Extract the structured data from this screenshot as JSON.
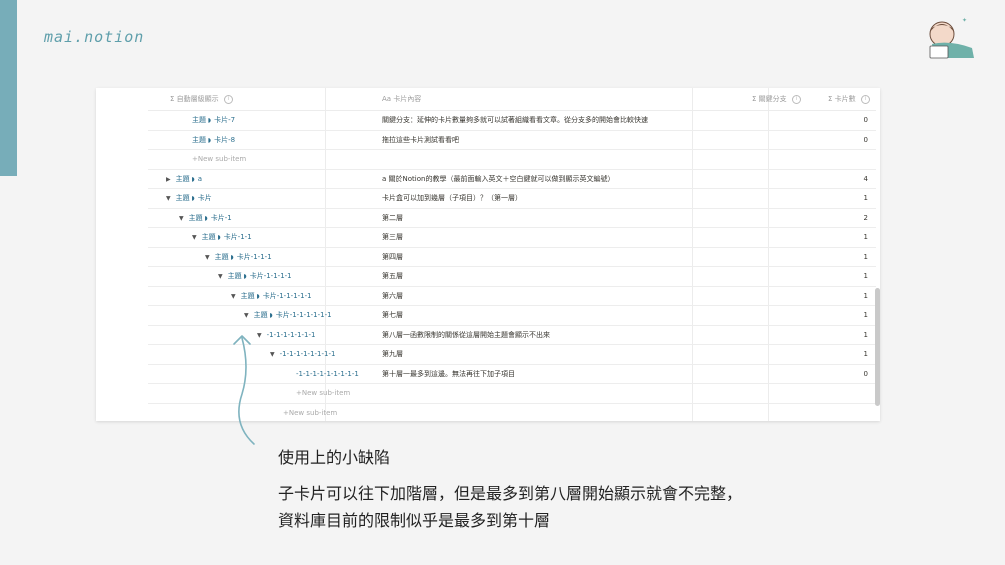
{
  "brand": "mai.notion",
  "columns": {
    "c1": "自動層級顯示",
    "c2": "卡片內容",
    "c2_prefix": "Aa",
    "c3": "關鍵分支",
    "c4": "卡片數",
    "sigma": "Σ",
    "info": "i"
  },
  "rows": [
    {
      "indent": 44,
      "toggle": "",
      "tag": "主題",
      "name": "卡片-7",
      "content": "關鍵分支：延伸的卡片數量夠多就可以試著組織看看文章。從分支多的開始會比較快速",
      "count": "0"
    },
    {
      "indent": 44,
      "toggle": "",
      "tag": "主題",
      "name": "卡片-8",
      "content": "拖拉這些卡片測試看看吧",
      "count": "0"
    },
    {
      "indent": 44,
      "new": true,
      "label": "New sub-item"
    },
    {
      "indent": 18,
      "toggle": "▶",
      "tag": "主題",
      "name": "a",
      "content": "a 關於Notion的教學（最前面輸入英文＋空白鍵就可以做到顯示英文編號）",
      "count": "4"
    },
    {
      "indent": 18,
      "toggle": "▼",
      "tag": "主題",
      "name": "卡片",
      "content": "卡片盒可以加到幾層（子項目）？（第一層）",
      "count": "1"
    },
    {
      "indent": 31,
      "toggle": "▼",
      "tag": "主題",
      "name": "卡片-1",
      "content": "第二層",
      "count": "2"
    },
    {
      "indent": 44,
      "toggle": "▼",
      "tag": "主題",
      "name": "卡片-1-1",
      "content": "第三層",
      "count": "1"
    },
    {
      "indent": 57,
      "toggle": "▼",
      "tag": "主題",
      "name": "卡片-1-1-1",
      "content": "第四層",
      "count": "1"
    },
    {
      "indent": 70,
      "toggle": "▼",
      "tag": "主題",
      "name": "卡片-1-1-1-1",
      "content": "第五層",
      "count": "1"
    },
    {
      "indent": 83,
      "toggle": "▼",
      "tag": "主題",
      "name": "卡片-1-1-1-1-1",
      "content": "第六層",
      "count": "1"
    },
    {
      "indent": 96,
      "toggle": "▼",
      "tag": "主題",
      "name": "卡片-1-1-1-1-1-1",
      "content": "第七層",
      "count": "1"
    },
    {
      "indent": 109,
      "toggle": "▼",
      "tag": "",
      "name": "-1-1-1-1-1-1-1",
      "content": "第八層一函數限制的關係從這層開始主題會顯示不出來",
      "count": "1"
    },
    {
      "indent": 122,
      "toggle": "▼",
      "tag": "",
      "name": "-1-1-1-1-1-1-1-1",
      "content": "第九層",
      "count": "1"
    },
    {
      "indent": 148,
      "toggle": "",
      "tag": "",
      "name": "-1-1-1-1-1-1-1-1-1",
      "content": "第十層一最多到這邊。無法再往下加子項目",
      "count": "0"
    },
    {
      "indent": 148,
      "new": true,
      "label": "New sub-item"
    },
    {
      "indent": 135,
      "new": true,
      "label": "New sub-item"
    },
    {
      "indent": 122,
      "new": true,
      "label": "New sub-item"
    }
  ],
  "note": {
    "title": "使用上的小缺陷",
    "line1": "子卡片可以往下加階層，但是最多到第八層開始顯示就會不完整，",
    "line2": "資料庫目前的限制似乎是最多到第十層"
  },
  "colors": {
    "accent": "#77adb9",
    "link": "#2c6f8e"
  }
}
